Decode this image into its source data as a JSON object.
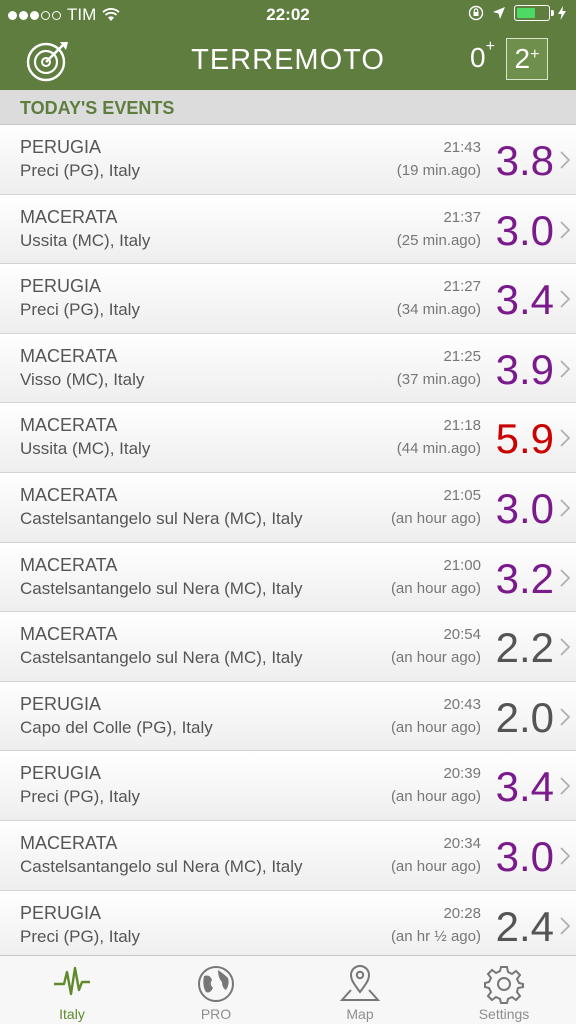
{
  "status_bar": {
    "carrier": "TIM",
    "time": "22:02",
    "signal_dots_filled": 3,
    "signal_dots_total": 5,
    "battery_level": 0.6
  },
  "nav": {
    "title": "TERREMOTO",
    "filter_zero": "0",
    "filter_two": "2",
    "plus": "+",
    "left_icon": "radar-icon"
  },
  "section": {
    "title": "TODAY'S EVENTS"
  },
  "colors": {
    "brand": "#5e7d3f",
    "purple": "#7a1a8c",
    "red": "#cc0000",
    "gray": "#555555"
  },
  "events": [
    {
      "province": "PERUGIA",
      "place": "Preci (PG), Italy",
      "time": "21:43",
      "ago": "(19 min.ago)",
      "mag": "3.8",
      "color": "#7a1a8c"
    },
    {
      "province": "MACERATA",
      "place": "Ussita (MC), Italy",
      "time": "21:37",
      "ago": "(25 min.ago)",
      "mag": "3.0",
      "color": "#7a1a8c"
    },
    {
      "province": "PERUGIA",
      "place": "Preci (PG), Italy",
      "time": "21:27",
      "ago": "(34 min.ago)",
      "mag": "3.4",
      "color": "#7a1a8c"
    },
    {
      "province": "MACERATA",
      "place": "Visso (MC), Italy",
      "time": "21:25",
      "ago": "(37 min.ago)",
      "mag": "3.9",
      "color": "#7a1a8c"
    },
    {
      "province": "MACERATA",
      "place": "Ussita (MC), Italy",
      "time": "21:18",
      "ago": "(44 min.ago)",
      "mag": "5.9",
      "color": "#cc0000"
    },
    {
      "province": "MACERATA",
      "place": "Castelsantangelo sul Nera (MC), Italy",
      "time": "21:05",
      "ago": "(an hour ago)",
      "mag": "3.0",
      "color": "#7a1a8c"
    },
    {
      "province": "MACERATA",
      "place": "Castelsantangelo sul Nera (MC), Italy",
      "time": "21:00",
      "ago": "(an hour ago)",
      "mag": "3.2",
      "color": "#7a1a8c"
    },
    {
      "province": "MACERATA",
      "place": "Castelsantangelo sul Nera (MC), Italy",
      "time": "20:54",
      "ago": "(an hour ago)",
      "mag": "2.2",
      "color": "#555555"
    },
    {
      "province": "PERUGIA",
      "place": "Capo del Colle (PG), Italy",
      "time": "20:43",
      "ago": "(an hour ago)",
      "mag": "2.0",
      "color": "#555555"
    },
    {
      "province": "PERUGIA",
      "place": "Preci (PG), Italy",
      "time": "20:39",
      "ago": "(an hour ago)",
      "mag": "3.4",
      "color": "#7a1a8c"
    },
    {
      "province": "MACERATA",
      "place": "Castelsantangelo sul Nera (MC), Italy",
      "time": "20:34",
      "ago": "(an hour ago)",
      "mag": "3.0",
      "color": "#7a1a8c"
    },
    {
      "province": "PERUGIA",
      "place": "Preci (PG), Italy",
      "time": "20:28",
      "ago": "(an hr ½ ago)",
      "mag": "2.4",
      "color": "#555555"
    }
  ],
  "tabs": [
    {
      "label": "Italy",
      "icon": "seismograph-icon",
      "active": true
    },
    {
      "label": "PRO",
      "icon": "globe-icon",
      "active": false
    },
    {
      "label": "Map",
      "icon": "map-pin-icon",
      "active": false
    },
    {
      "label": "Settings",
      "icon": "gear-icon",
      "active": false
    }
  ]
}
